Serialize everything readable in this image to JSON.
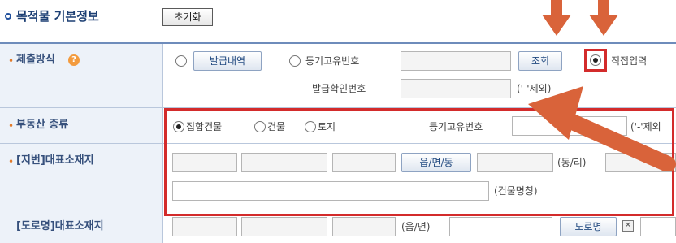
{
  "header": {
    "title": "목적물 기본정보",
    "reset_label": "초기화"
  },
  "rows": {
    "submit_method": {
      "label": "제출방식",
      "opt_issue_btn": "발급내역",
      "opt_reg_no": "등기고유번호",
      "lookup_btn": "조회",
      "opt_direct": "직접입력",
      "issue_confirm_label": "발급확인번호",
      "hint": "('-'제외)"
    },
    "property_type": {
      "label": "부동산 종류",
      "opt_collective": "집합건물",
      "opt_building": "건물",
      "opt_land": "토지",
      "reg_no_label": "등기고유번호",
      "hint": "('-'제외"
    },
    "lot_address": {
      "label": "[지번]대표소재지",
      "town_btn": "읍/면/동",
      "village_label": "(동/리)",
      "building_name_label": "(건물명칭)"
    },
    "road_address": {
      "label": "[도로명]대표소재지",
      "town_label": "(읍/면)",
      "road_btn": "도로명"
    }
  },
  "colors": {
    "highlight": "#d32b2b",
    "arrow": "#d9633a",
    "label_bg": "#edf2f9"
  }
}
